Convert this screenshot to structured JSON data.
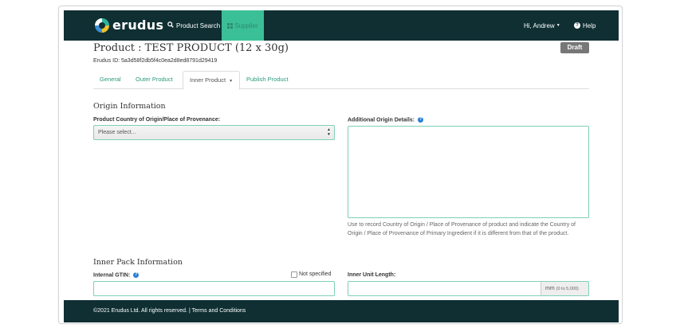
{
  "nav": {
    "brand": "erudus",
    "product_search": "Product Search",
    "supplier": "Supplier",
    "user": "Hi, Andrew",
    "help": "Help"
  },
  "product": {
    "title": "Product : TEST PRODUCT (12 x 30g)",
    "erudus_id": "Erudus ID: 5a3d58f2db5f4c0ea2d8ed8791d29419",
    "status": "Draft"
  },
  "tabs": [
    {
      "label": "General"
    },
    {
      "label": "Outer Product"
    },
    {
      "label": "Inner Product"
    },
    {
      "label": "Publish Product"
    }
  ],
  "origin": {
    "section_title": "Origin Information",
    "country_label": "Product Country of Origin/Place of Provenance:",
    "country_placeholder": "Please select...",
    "additional_label": "Additional Origin Details:",
    "additional_help": "Use to record Country of Origin / Place of Provenance of product and indicate the Country of Origin / Place of Provenance of Primary Ingredient if it is different from that of the product."
  },
  "inner_pack": {
    "section_title": "Inner Pack Information",
    "gtin_label": "Internal GTIN:",
    "not_specified": "Not specified",
    "length_label": "Inner Unit Length:",
    "length_unit": "mm",
    "length_range": "(0 to 5,000)"
  },
  "footer": {
    "text": "©2021 Erudus Ltd. All rights reserved. | Terms and Conditions"
  },
  "colors": {
    "navbar": "#0f2f33",
    "accent": "#3bbf96",
    "tab_link": "#2a9a7c",
    "draft_badge": "#777777"
  },
  "icons": [
    "search-icon",
    "grid-icon",
    "question-circle-icon",
    "caret-down-icon"
  ]
}
